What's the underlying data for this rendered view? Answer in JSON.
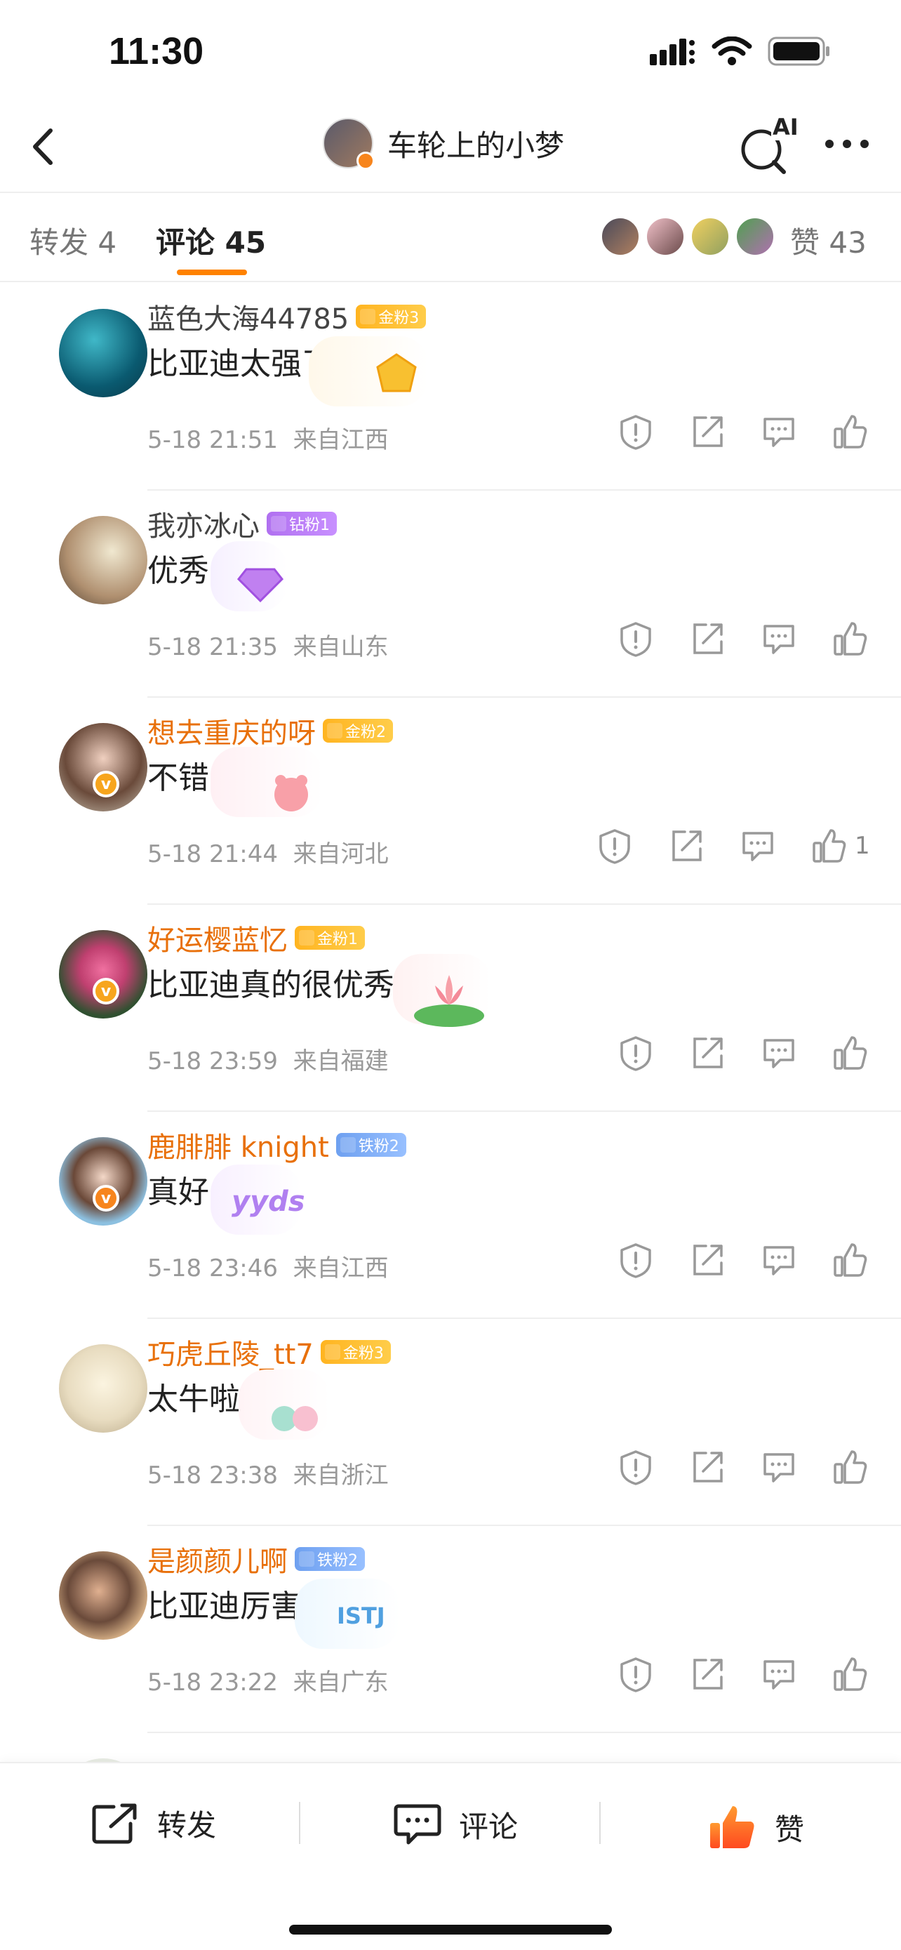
{
  "status": {
    "time": "11:30"
  },
  "nav": {
    "title": "车轮上的小梦",
    "ai_label": "AI"
  },
  "tabs": {
    "forward": "转发 4",
    "comments": "评论 45",
    "likes": "赞 43"
  },
  "colors": {
    "accent": "#ff8200",
    "name_vip": "#e8700a",
    "meta": "#999999"
  },
  "comments": [
    {
      "name": "蓝色大海44785",
      "badge": "金粉3",
      "badge_type": "gold",
      "text": "比亚迪太强了",
      "time": "5-18 21:51",
      "location": "来自江西",
      "likes": "",
      "vip": false
    },
    {
      "name": "我亦冰心",
      "badge": "钻粉1",
      "badge_type": "diamond",
      "text": "优秀",
      "time": "5-18 21:35",
      "location": "来自山东",
      "likes": "",
      "vip": false
    },
    {
      "name": "想去重庆的呀",
      "badge": "金粉2",
      "badge_type": "gold",
      "text": "不错👍",
      "time": "5-18 21:44",
      "location": "来自河北",
      "likes": "1",
      "vip": true
    },
    {
      "name": "好运樱蓝忆",
      "badge": "金粉1",
      "badge_type": "gold",
      "text": "比亚迪真的很优秀",
      "time": "5-18 23:59",
      "location": "来自福建",
      "likes": "",
      "vip": true
    },
    {
      "name": "鹿腓腓 knight",
      "badge": "铁粉2",
      "badge_type": "iron",
      "text": "真好",
      "time": "5-18 23:46",
      "location": "来自江西",
      "likes": "",
      "vip": true
    },
    {
      "name": "巧虎丘陵_tt7",
      "badge": "金粉3",
      "badge_type": "gold",
      "text": "太牛啦",
      "time": "5-18 23:38",
      "location": "来自浙江",
      "likes": "",
      "vip": true
    },
    {
      "name": "是颜颜儿啊",
      "badge": "铁粉2",
      "badge_type": "iron",
      "text": "比亚迪厉害",
      "time": "5-18 23:22",
      "location": "来自广东",
      "likes": "",
      "vip": true
    }
  ],
  "bottom": {
    "forward": "转发",
    "comment": "评论",
    "like": "赞"
  }
}
